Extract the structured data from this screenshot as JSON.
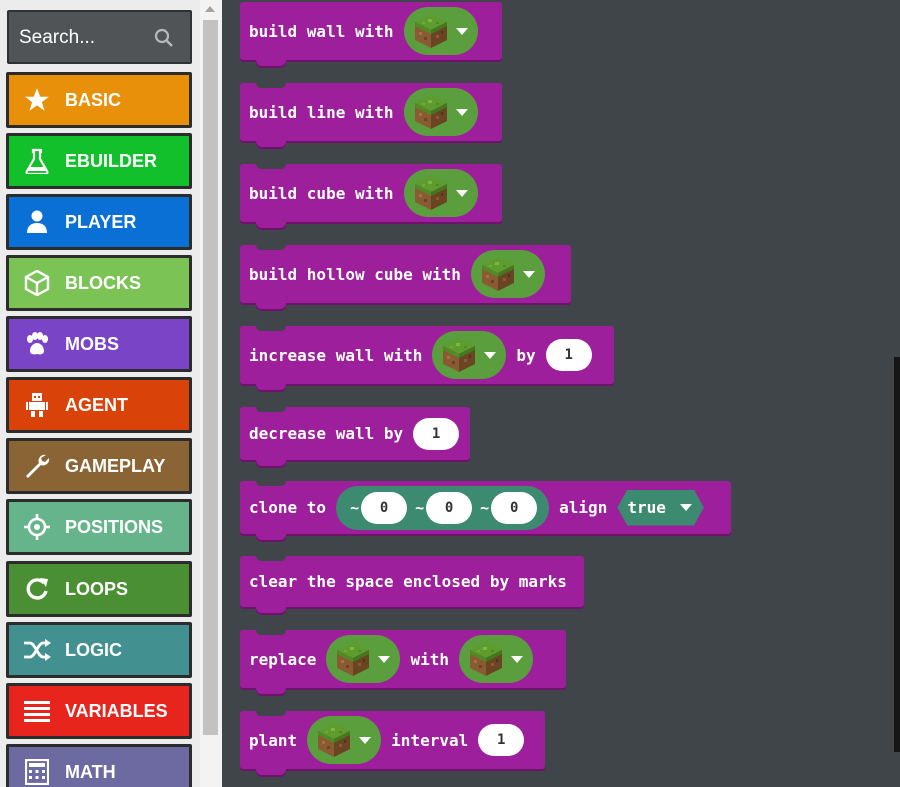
{
  "search": {
    "placeholder": "Search..."
  },
  "categories": [
    {
      "label": "BASIC",
      "icon": "star-icon",
      "color": "#e8900a"
    },
    {
      "label": "EBUILDER",
      "icon": "flask-icon",
      "color": "#12c02c"
    },
    {
      "label": "PLAYER",
      "icon": "person-icon",
      "color": "#0a70d6"
    },
    {
      "label": "BLOCKS",
      "icon": "cube-icon",
      "color": "#7cc356"
    },
    {
      "label": "MOBS",
      "icon": "paw-icon",
      "color": "#7a44c6"
    },
    {
      "label": "AGENT",
      "icon": "robot-icon",
      "color": "#d9430a"
    },
    {
      "label": "GAMEPLAY",
      "icon": "wrench-icon",
      "color": "#8a6434"
    },
    {
      "label": "POSITIONS",
      "icon": "crosshair-icon",
      "color": "#66b48c"
    },
    {
      "label": "LOOPS",
      "icon": "loop-icon",
      "color": "#4b8f34"
    },
    {
      "label": "LOGIC",
      "icon": "shuffle-icon",
      "color": "#429090"
    },
    {
      "label": "VARIABLES",
      "icon": "list-icon",
      "color": "#e8251d"
    },
    {
      "label": "MATH",
      "icon": "calculator-icon",
      "color": "#6c6aa0"
    }
  ],
  "blocks": {
    "build_wall": "build wall with",
    "build_line": "build line with",
    "build_cube": "build cube with",
    "build_hollow_cube": "build hollow cube with",
    "increase_wall": "increase wall with",
    "increase_by": "by",
    "increase_value": "1",
    "decrease_wall": "decrease wall by",
    "decrease_value": "1",
    "clone_to": "clone to",
    "tilde": "~",
    "clone_x": "0",
    "clone_y": "0",
    "clone_z": "0",
    "align": "align",
    "align_value": "true",
    "clear_space": "clear the space enclosed by marks",
    "replace": "replace",
    "replace_with": "with",
    "plant": "plant",
    "plant_interval": "interval",
    "plant_value": "1"
  },
  "colors": {
    "block": "#9d1f9b",
    "dropdown": "#5b9e3e",
    "position": "#3c8a70",
    "workspace": "#3f4549"
  }
}
